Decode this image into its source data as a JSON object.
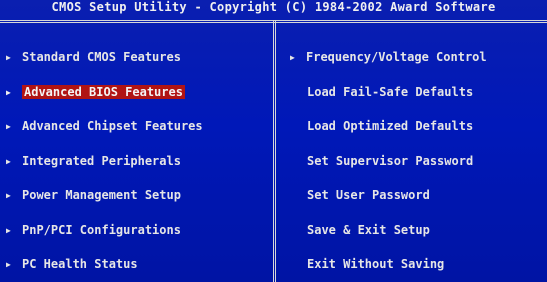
{
  "title": "CMOS Setup Utility - Copyright (C) 1984-2002 Award Software",
  "colors": {
    "background": "#0016b0",
    "text": "#e6e6e6",
    "highlight": "#b01414"
  },
  "left_menu": {
    "items": [
      {
        "label": "Standard CMOS Features",
        "icon": "triangle-right-icon"
      },
      {
        "label": "Advanced BIOS Features",
        "icon": "triangle-right-icon",
        "selected": true
      },
      {
        "label": "Advanced Chipset Features",
        "icon": "triangle-right-icon"
      },
      {
        "label": "Integrated Peripherals",
        "icon": "triangle-right-icon"
      },
      {
        "label": "Power Management Setup",
        "icon": "triangle-right-icon"
      },
      {
        "label": "PnP/PCI Configurations",
        "icon": "triangle-right-icon"
      },
      {
        "label": "PC Health Status",
        "icon": "triangle-right-icon"
      }
    ]
  },
  "right_menu": {
    "items": [
      {
        "label": "Frequency/Voltage Control",
        "icon": "triangle-right-icon"
      },
      {
        "label": "Load Fail-Safe Defaults"
      },
      {
        "label": "Load Optimized Defaults"
      },
      {
        "label": "Set Supervisor Password"
      },
      {
        "label": "Set User Password"
      },
      {
        "label": "Save & Exit Setup"
      },
      {
        "label": "Exit Without Saving"
      }
    ]
  }
}
